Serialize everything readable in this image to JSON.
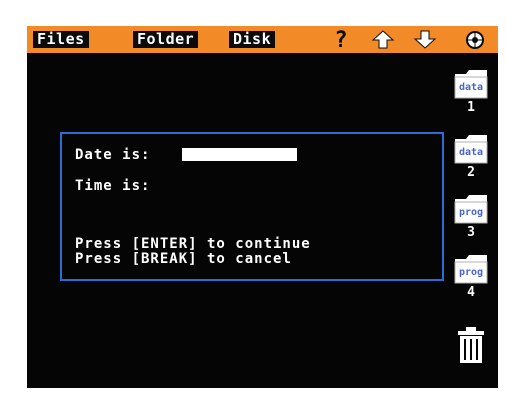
{
  "menubar": {
    "files_label": "Files",
    "folder_label": "Folder",
    "disk_label": "Disk",
    "icons": [
      "help-icon",
      "up-arrow-icon",
      "down-arrow-icon",
      "options-icon"
    ],
    "help_glyph": "?"
  },
  "dialog": {
    "date_label": "Date is:",
    "date_value": "",
    "time_label": "Time is:",
    "enter_prompt": "Press [ENTER] to continue",
    "break_prompt": "Press [BREAK] to cancel"
  },
  "folders": [
    {
      "label": "data",
      "number": "1"
    },
    {
      "label": "data",
      "number": "2"
    },
    {
      "label": "prog",
      "number": "3"
    },
    {
      "label": "prog",
      "number": "4"
    }
  ],
  "trash": {
    "icon": "trash-icon"
  },
  "colors": {
    "menubar": "#f28a28",
    "screen": "#050505",
    "dialog_border": "#2e6bd8",
    "folder_label": "#4a63d0"
  }
}
